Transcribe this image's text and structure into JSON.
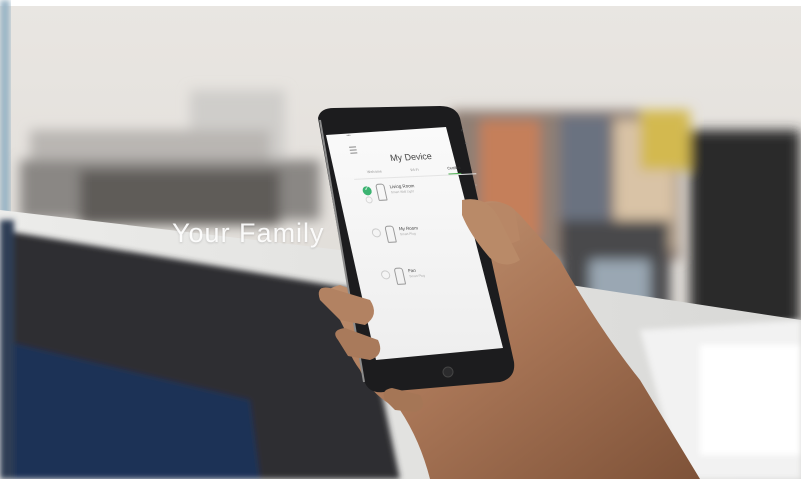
{
  "overlay": {
    "text": "Your Family"
  },
  "app": {
    "title": "My Device",
    "tabs": [
      {
        "label": "Welcome",
        "active": false
      },
      {
        "label": "Wi-Fi",
        "active": false
      },
      {
        "label": "Certified",
        "active": true
      }
    ],
    "devices": [
      {
        "name": "Living Room",
        "sub": "Smart Wall Light",
        "selected": true
      },
      {
        "name": "My Room",
        "sub": "Smart Plug",
        "selected": false
      },
      {
        "name": "Fan",
        "sub": "Smart Plug",
        "selected": false
      }
    ]
  },
  "colors": {
    "accent": "#3cb371",
    "screen": "#f7f7f7"
  }
}
